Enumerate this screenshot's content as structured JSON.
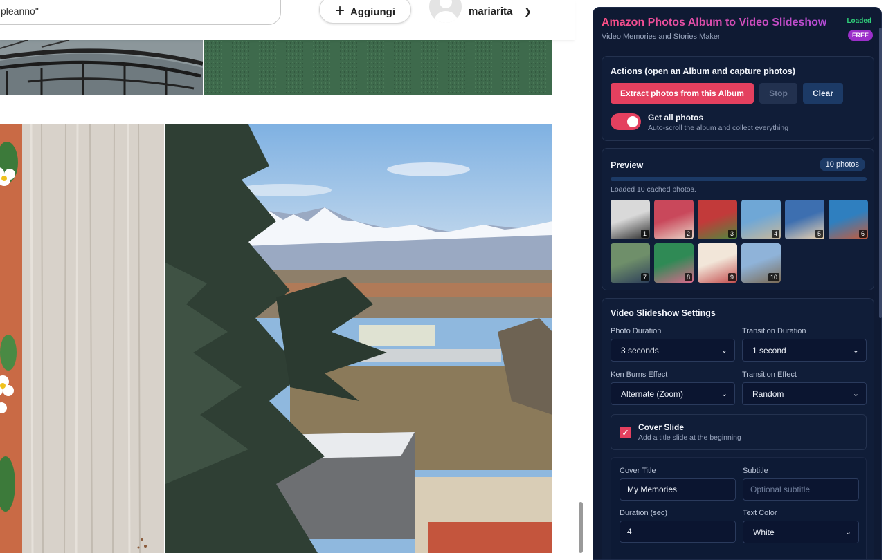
{
  "page": {
    "search_text": "pleanno\"",
    "add_button_label": "Aggiungi",
    "username": "mariarita"
  },
  "extension": {
    "title": "Amazon Photos Album to Video Slideshow",
    "subtitle": "Video Memories and Stories Maker",
    "status": "Loaded",
    "badge": "FREE",
    "actions": {
      "title": "Actions (open an Album and capture photos)",
      "extract_label": "Extract photos from this Album",
      "stop_label": "Stop",
      "clear_label": "Clear",
      "toggle_label": "Get all photos",
      "toggle_desc": "Auto-scroll the album and collect everything",
      "toggle_on": true
    },
    "preview": {
      "title": "Preview",
      "count": "10 photos",
      "status": "Loaded 10 cached photos.",
      "progress": 1.0,
      "thumbs": [
        {
          "num": "1",
          "color_a": "#d9d9d9",
          "color_b": "#2b2b2b"
        },
        {
          "num": "2",
          "color_a": "#c9485b",
          "color_b": "#e8d6c8"
        },
        {
          "num": "3",
          "color_a": "#c23a3a",
          "color_b": "#4e8a3e"
        },
        {
          "num": "4",
          "color_a": "#6fa7d6",
          "color_b": "#c9b89a"
        },
        {
          "num": "5",
          "color_a": "#3d6fb0",
          "color_b": "#f0d5b0"
        },
        {
          "num": "6",
          "color_a": "#2f7fbf",
          "color_b": "#c75b3a"
        },
        {
          "num": "7",
          "color_a": "#6f8f6a",
          "color_b": "#2d3f5a"
        },
        {
          "num": "8",
          "color_a": "#2f8a55",
          "color_b": "#d96a8c"
        },
        {
          "num": "9",
          "color_a": "#f2e6d9",
          "color_b": "#c34f4f"
        },
        {
          "num": "10",
          "color_a": "#8fb3d9",
          "color_b": "#7a6a55"
        }
      ]
    },
    "video": {
      "title": "Video Slideshow Settings",
      "photo_duration_label": "Photo Duration",
      "photo_duration_value": "3 seconds",
      "transition_duration_label": "Transition Duration",
      "transition_duration_value": "1 second",
      "ken_burns_label": "Ken Burns Effect",
      "ken_burns_value": "Alternate (Zoom)",
      "transition_effect_label": "Transition Effect",
      "transition_effect_value": "Random",
      "cover_slide_label": "Cover Slide",
      "cover_slide_desc": "Add a title slide at the beginning",
      "cover_slide_checked": true,
      "cover_title_label": "Cover Title",
      "cover_title_value": "My Memories",
      "subtitle_label": "Subtitle",
      "subtitle_placeholder": "Optional subtitle",
      "duration_label": "Duration (sec)",
      "duration_value": "4",
      "text_color_label": "Text Color",
      "text_color_value": "White"
    }
  }
}
